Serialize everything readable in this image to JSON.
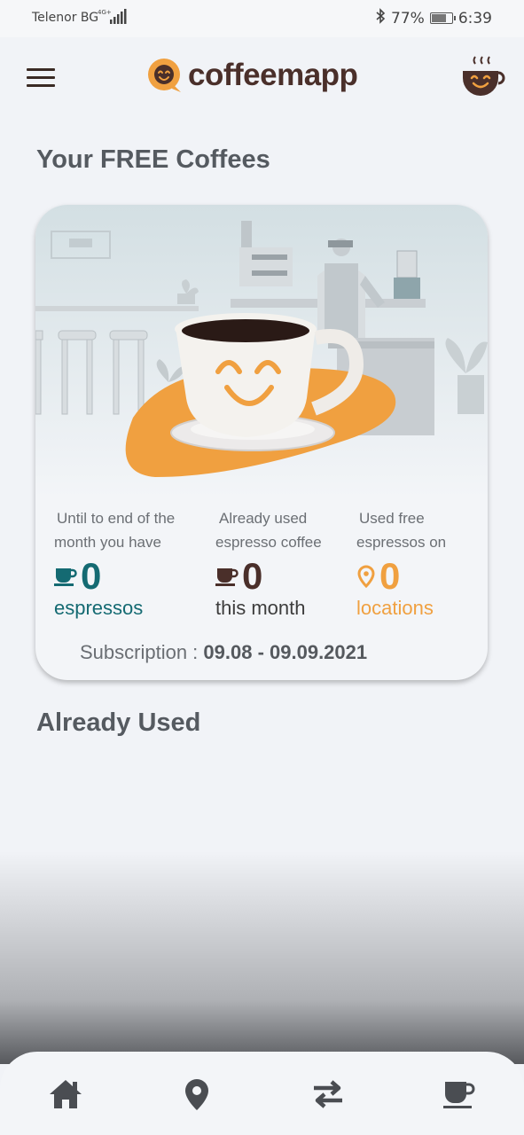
{
  "status_bar": {
    "carrier": "Telenor BG",
    "network": "4G+",
    "battery_percent": "77%",
    "battery_level": 0.77,
    "time": "6:39"
  },
  "header": {
    "app_name": "coffeemapp",
    "menu_icon": "hamburger-menu-icon",
    "profile_icon": "smiling-cup-icon"
  },
  "free_coffees": {
    "title": "Your FREE Coffees",
    "stats": [
      {
        "label_line1": "Until to end of the",
        "label_line2": "month you have",
        "value": "0",
        "unit": "espressos",
        "icon": "coffee-cup-icon",
        "color": "#146a72"
      },
      {
        "label_line1": "Already used",
        "label_line2": "espresso coffee",
        "value": "0",
        "unit": "this month",
        "icon": "coffee-cup-icon",
        "color": "#4a2f2a"
      },
      {
        "label_line1": "Used free",
        "label_line2": "espressos on",
        "value": "0",
        "unit": "locations",
        "icon": "location-pin-icon",
        "color": "#f0a040"
      }
    ],
    "subscription_label": "Subscription : ",
    "subscription_range": "09.08 - 09.09.2021"
  },
  "already_used": {
    "title": "Already Used"
  },
  "bottom_nav": {
    "items": [
      "home-icon",
      "location-pin-icon",
      "transfer-arrows-icon",
      "coffee-cup-icon"
    ]
  },
  "colors": {
    "brand_brown": "#4a2f2a",
    "brand_orange": "#f0a040",
    "teal": "#146a72"
  }
}
